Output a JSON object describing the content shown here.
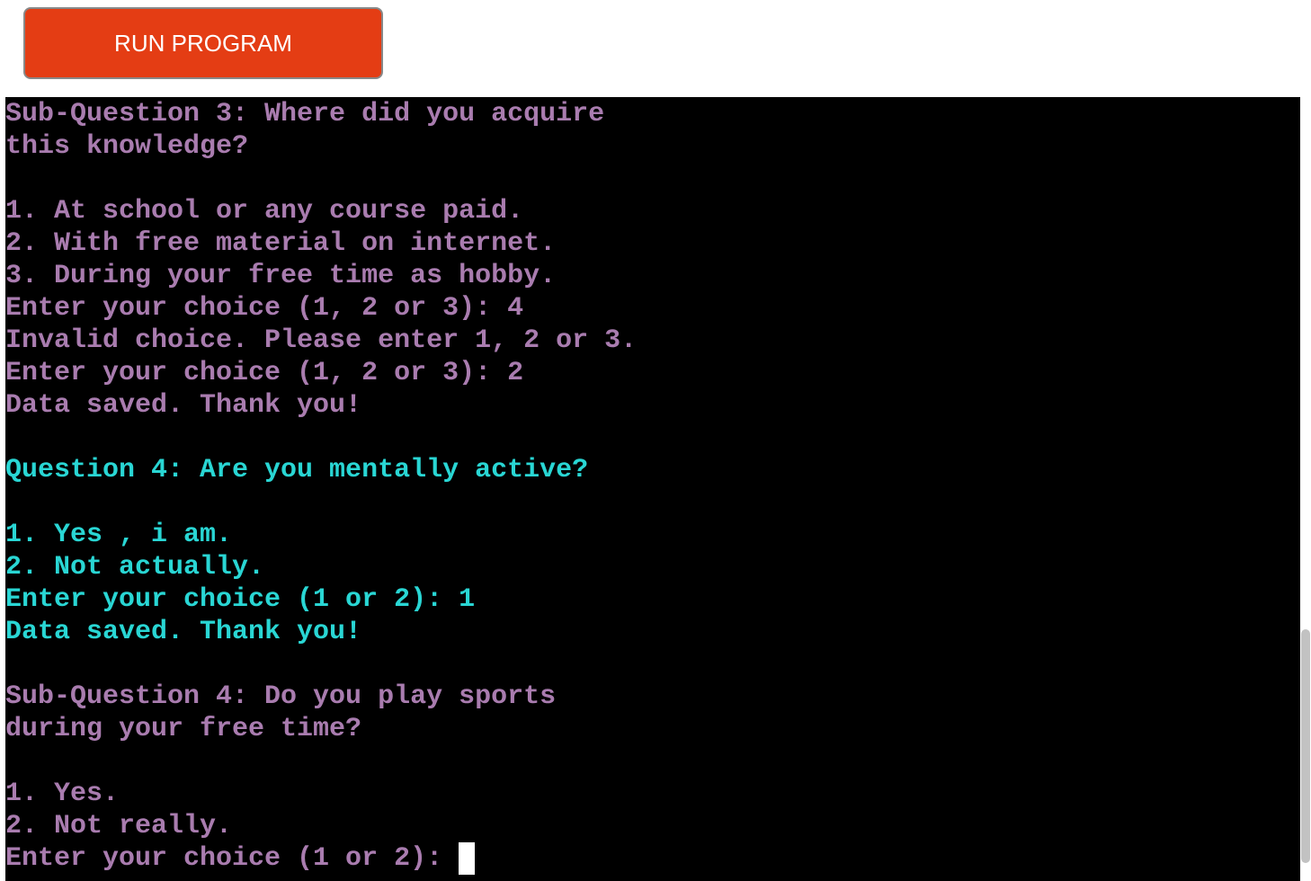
{
  "run_button": {
    "label": "RUN PROGRAM"
  },
  "colors": {
    "accent": "#e43d14",
    "sub_question_text": "#a97caf",
    "question_text": "#29d6d4",
    "terminal_background": "#000000",
    "cursor": "#ffffff"
  },
  "terminal": {
    "lines": [
      {
        "text": "Sub-Question 3: Where did you acquire",
        "color": "#a97caf"
      },
      {
        "text": "this knowledge?",
        "color": "#a97caf"
      },
      {
        "text": "",
        "color": "#a97caf"
      },
      {
        "text": "1. At school or any course paid.",
        "color": "#a97caf"
      },
      {
        "text": "2. With free material on internet.",
        "color": "#a97caf"
      },
      {
        "text": "3. During your free time as hobby.",
        "color": "#a97caf"
      },
      {
        "text": "Enter your choice (1, 2 or 3): 4",
        "color": "#a97caf"
      },
      {
        "text": "Invalid choice. Please enter 1, 2 or 3.",
        "color": "#a97caf"
      },
      {
        "text": "Enter your choice (1, 2 or 3): 2",
        "color": "#a97caf"
      },
      {
        "text": "Data saved. Thank you!",
        "color": "#a97caf"
      },
      {
        "text": "",
        "color": "#a97caf"
      },
      {
        "text": "Question 4: Are you mentally active?",
        "color": "#29d6d4"
      },
      {
        "text": "",
        "color": "#29d6d4"
      },
      {
        "text": "1. Yes , i am.",
        "color": "#29d6d4"
      },
      {
        "text": "2. Not actually.",
        "color": "#29d6d4"
      },
      {
        "text": "Enter your choice (1 or 2): 1",
        "color": "#29d6d4"
      },
      {
        "text": "Data saved. Thank you!",
        "color": "#29d6d4"
      },
      {
        "text": "",
        "color": "#29d6d4"
      },
      {
        "text": "Sub-Question 4: Do you play sports",
        "color": "#a97caf"
      },
      {
        "text": "during your free time?",
        "color": "#a97caf"
      },
      {
        "text": "",
        "color": "#a97caf"
      },
      {
        "text": "1. Yes.",
        "color": "#a97caf"
      },
      {
        "text": "2. Not really.",
        "color": "#a97caf"
      },
      {
        "text": "Enter your choice (1 or 2): ",
        "color": "#a97caf",
        "cursor": true
      }
    ]
  },
  "scrollbar": {
    "scroll_position": 0.95
  }
}
